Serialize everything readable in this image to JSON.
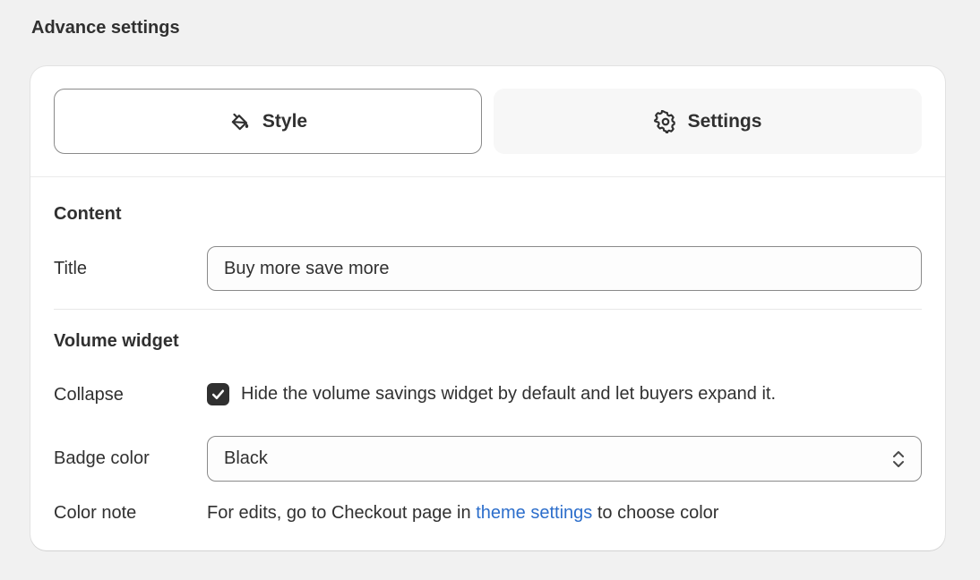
{
  "section": {
    "title": "Advance settings"
  },
  "tabs": [
    {
      "label": "Style",
      "icon": "paint-bucket-icon",
      "selected": true
    },
    {
      "label": "Settings",
      "icon": "gear-icon",
      "selected": false
    }
  ],
  "content": {
    "heading": "Content",
    "title_label": "Title",
    "title_value": "Buy more save more"
  },
  "volume_widget": {
    "heading": "Volume widget",
    "collapse_label": "Collapse",
    "collapse_checked": true,
    "collapse_text": "Hide the volume savings widget by default and let buyers expand it.",
    "badge_label": "Badge color",
    "badge_value": "Black",
    "note_label": "Color note",
    "note_prefix": "For edits, go to Checkout page in",
    "note_link": "theme settings",
    "note_suffix": "to choose color"
  },
  "colors": {
    "link": "#2c6ecb",
    "text": "#303030",
    "background": "#f1f1f1"
  }
}
